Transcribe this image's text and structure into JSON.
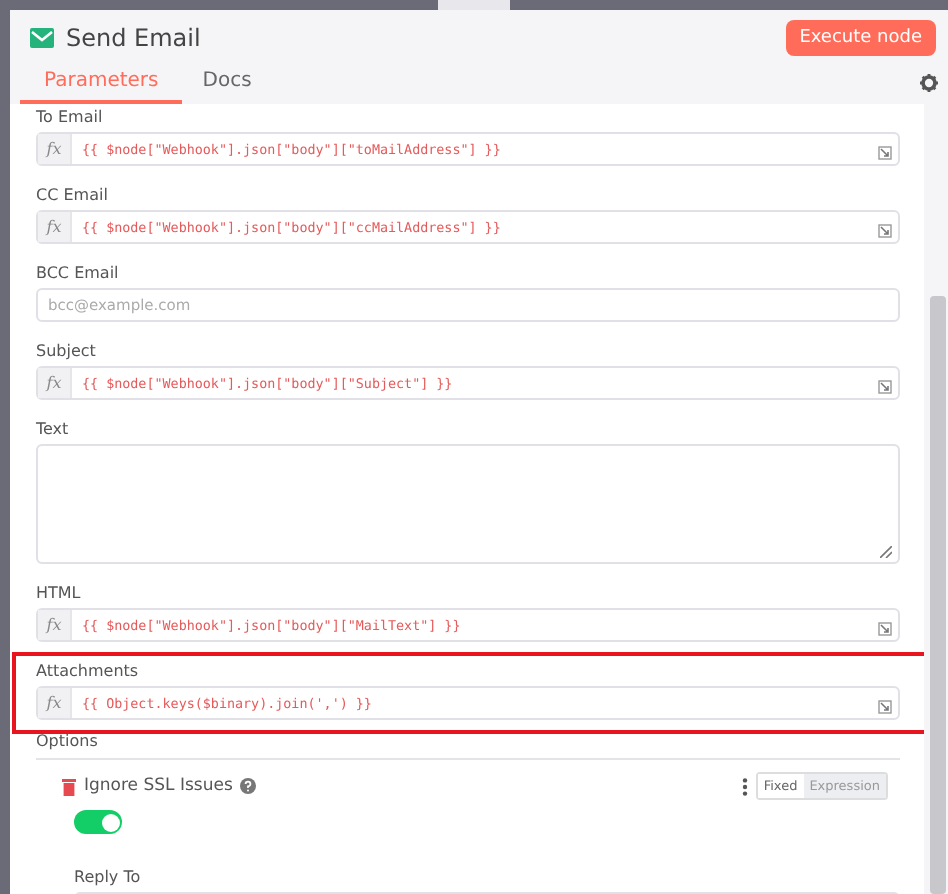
{
  "header": {
    "title": "Send Email",
    "execute_button": "Execute node"
  },
  "tabs": [
    {
      "label": "Parameters",
      "selected": true
    },
    {
      "label": "Docs",
      "selected": false
    }
  ],
  "parameters": [
    {
      "label": "To Email",
      "kind": "expression",
      "prefix": "fx",
      "value": "{{ $node[\"Webhook\"].json[\"body\"][\"toMailAddress\"] }}",
      "highlighted": false
    },
    {
      "label": "CC Email",
      "kind": "expression",
      "prefix": "fx",
      "value": "{{ $node[\"Webhook\"].json[\"body\"][\"ccMailAddress\"] }}",
      "highlighted": false
    },
    {
      "label": "BCC Email",
      "kind": "text",
      "placeholder": "bcc@example.com",
      "highlighted": false
    },
    {
      "label": "Subject",
      "kind": "expression",
      "prefix": "fx",
      "value": "{{ $node[\"Webhook\"].json[\"body\"][\"Subject\"] }}",
      "highlighted": false
    },
    {
      "label": "Text",
      "kind": "textarea",
      "highlighted": false
    },
    {
      "label": "HTML",
      "kind": "expression",
      "prefix": "fx",
      "value": "{{ $node[\"Webhook\"].json[\"body\"][\"MailText\"] }}",
      "highlighted": false
    },
    {
      "label": "Attachments",
      "kind": "expression",
      "prefix": "fx",
      "value": "{{ Object.keys($binary).join(',') }}",
      "highlighted": true
    }
  ],
  "options": {
    "label": "Options",
    "items": [
      {
        "label": "Ignore SSL Issues",
        "kind": "toggle",
        "on": true,
        "modes": [
          {
            "label": "Fixed",
            "selected": true
          },
          {
            "label": "Expression",
            "selected": false
          }
        ]
      },
      {
        "label": "Reply To",
        "kind": "text"
      }
    ]
  }
}
